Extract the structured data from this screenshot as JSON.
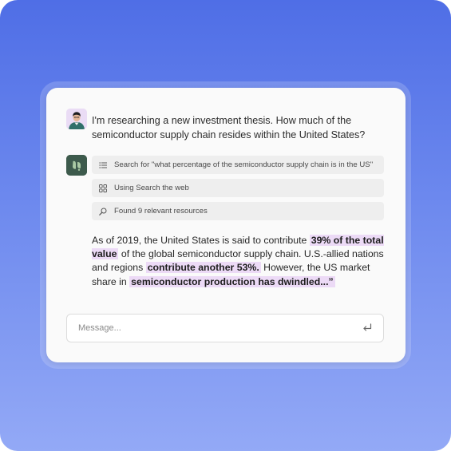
{
  "conversation": {
    "user_message": "I'm researching a new investment thesis. How much of the semiconductor supply chain resides within the United States?",
    "steps": [
      {
        "icon": "list-icon",
        "label": "Search for \"what percentage of the semiconductor supply chain is in the US\""
      },
      {
        "icon": "apps-grid-icon",
        "label": "Using Search the web"
      },
      {
        "icon": "magnifier-icon",
        "label": "Found 9 relevant resources"
      }
    ],
    "answer": {
      "part1": "As of 2019, the United States is said to contribute ",
      "highlight1": "39% of the total value",
      "part2": " of the global semiconductor supply chain. U.S.-allied nations and regions ",
      "highlight2": "contribute another 53%.",
      "part3": " However, the US market share in ",
      "highlight3": "semiconductor production has dwindled...”"
    }
  },
  "composer": {
    "placeholder": "Message...",
    "send_icon": "enter-return-icon"
  },
  "colors": {
    "background_top": "#4f6ee6",
    "background_bottom": "#93a9f6",
    "highlight": "#ecdaf6",
    "assistant_avatar": "#3d5a4c",
    "user_avatar_bg": "#eadcf5"
  }
}
